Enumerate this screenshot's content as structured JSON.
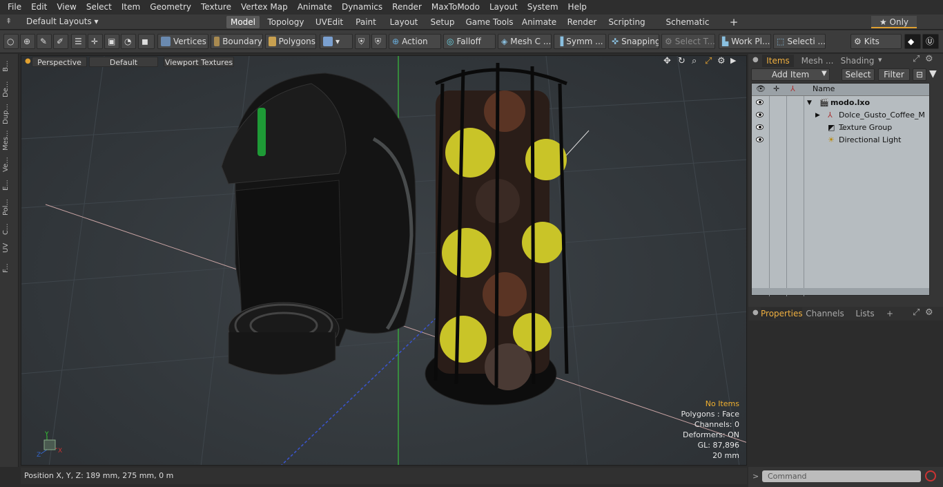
{
  "menu": [
    "File",
    "Edit",
    "View",
    "Select",
    "Item",
    "Geometry",
    "Texture",
    "Vertex Map",
    "Animate",
    "Dynamics",
    "Render",
    "MaxToModo",
    "Layout",
    "System",
    "Help"
  ],
  "layouts": {
    "label": "Default Layouts ▾",
    "tabs": [
      "Model",
      "Topology",
      "UVEdit",
      "Paint",
      "Layout",
      "Setup",
      "Game Tools",
      "Animate",
      "Render",
      "Scripting",
      "Schematic Fusion"
    ],
    "add": "+",
    "only": "★ Only"
  },
  "toolbar": {
    "vertices": "Vertices",
    "boundary": "Boundary",
    "polygons": "Polygons",
    "action": "Action",
    "falloff": "Falloff",
    "mesh": "Mesh C ...",
    "symm": "Symm ...",
    "snapping": "Snapping",
    "select_t": "Select T...",
    "work": "Work Pl...",
    "selecti": "Selecti ...",
    "kits": "Kits"
  },
  "sidetabs": [
    "B...",
    "De...",
    "Dup...",
    "Mes...",
    "Ve...",
    "E...",
    "Pol...",
    "C...",
    "UV",
    "F..."
  ],
  "viewport": {
    "view": "Perspective",
    "shading": "Default",
    "textures": "Viewport Textures"
  },
  "hud": {
    "items": "No Items",
    "polygons": "Polygons : Face",
    "channels": "Channels: 0",
    "deformers": "Deformers: ON",
    "gl": "GL: 87,896",
    "scale": "20 mm"
  },
  "status": "Position X, Y, Z:   189 mm, 275 mm, 0 m",
  "items_panel": {
    "tabs": [
      "Items",
      "Mesh ...",
      "Shading"
    ],
    "add_item": "Add Item",
    "select": "Select",
    "filter": "Filter",
    "name_col": "Name",
    "rows": [
      "modo.lxo",
      "Dolce_Gusto_Coffee_M ...",
      "Texture Group",
      "Directional Light"
    ]
  },
  "props_panel": {
    "tabs": [
      "Properties",
      "Channels",
      "Lists"
    ],
    "add": "+"
  },
  "command": {
    "placeholder": "Command"
  }
}
